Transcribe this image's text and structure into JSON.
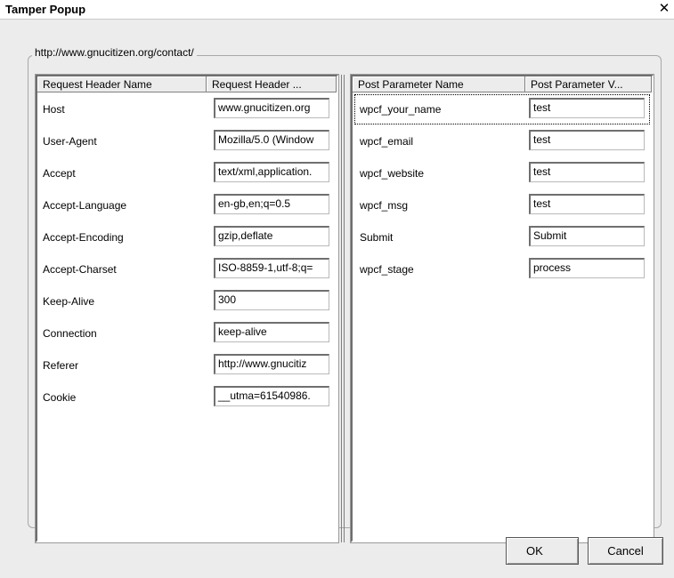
{
  "window": {
    "title": "Tamper Popup",
    "close_glyph": "✕"
  },
  "url_label": "http://www.gnucitizen.org/contact/",
  "headers_table": {
    "columns": [
      "Request Header Name",
      "Request Header ..."
    ],
    "rows": [
      {
        "name": "Host",
        "value": "www.gnucitizen.org"
      },
      {
        "name": "User-Agent",
        "value": "Mozilla/5.0 (Window"
      },
      {
        "name": "Accept",
        "value": "text/xml,application."
      },
      {
        "name": "Accept-Language",
        "value": "en-gb,en;q=0.5"
      },
      {
        "name": "Accept-Encoding",
        "value": "gzip,deflate"
      },
      {
        "name": "Accept-Charset",
        "value": "ISO-8859-1,utf-8;q="
      },
      {
        "name": "Keep-Alive",
        "value": "300"
      },
      {
        "name": "Connection",
        "value": "keep-alive"
      },
      {
        "name": "Referer",
        "value": "http://www.gnucitiz"
      },
      {
        "name": "Cookie",
        "value": "__utma=61540986."
      }
    ]
  },
  "post_table": {
    "columns": [
      "Post Parameter Name",
      "Post Parameter V..."
    ],
    "rows": [
      {
        "name": "wpcf_your_name",
        "value": "test"
      },
      {
        "name": "wpcf_email",
        "value": "test"
      },
      {
        "name": "wpcf_website",
        "value": "test"
      },
      {
        "name": "wpcf_msg",
        "value": "test"
      },
      {
        "name": "Submit",
        "value": "Submit"
      },
      {
        "name": "wpcf_stage",
        "value": "process"
      }
    ]
  },
  "buttons": {
    "ok": "OK",
    "cancel": "Cancel"
  }
}
